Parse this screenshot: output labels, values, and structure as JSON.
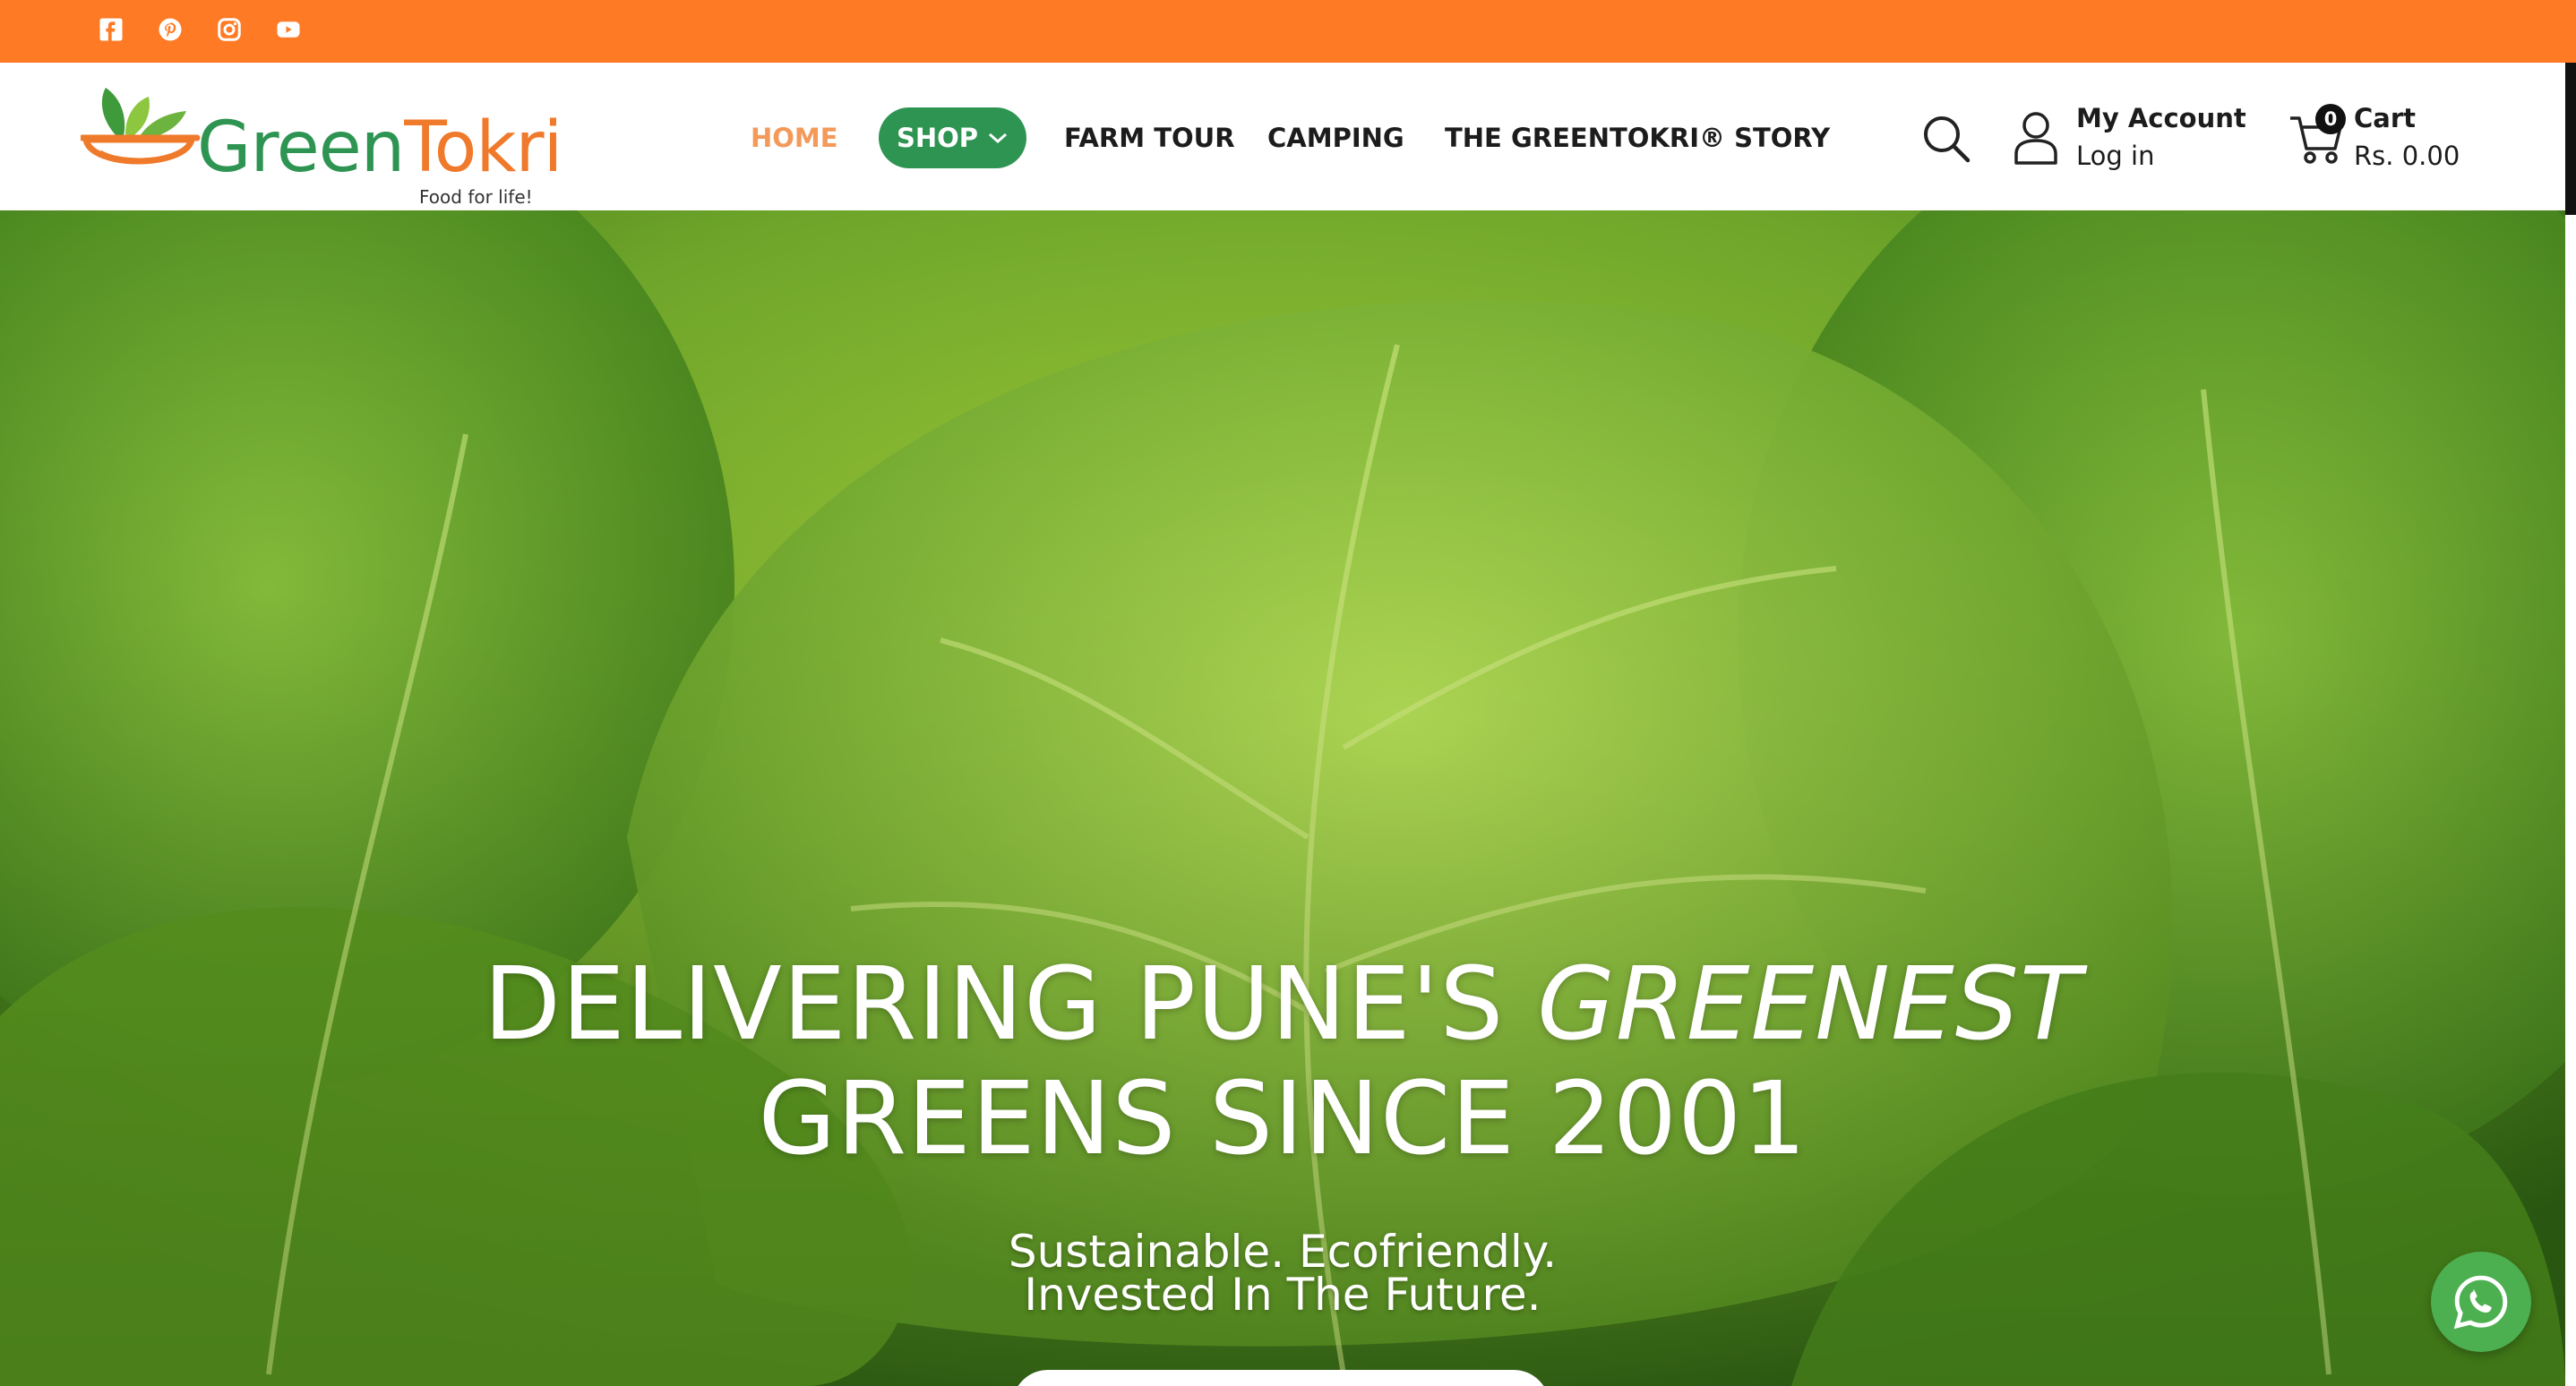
{
  "topbar": {
    "color": "#FF7A25",
    "social": [
      "facebook-icon",
      "pinterest-icon",
      "instagram-icon",
      "youtube-icon"
    ]
  },
  "brand": {
    "name_green": "Green",
    "name_orange": "Tokri",
    "tagline": "Food for life!",
    "green": "#2E9452",
    "orange": "#F07A2B"
  },
  "nav": {
    "home": "HOME",
    "shop": "SHOP",
    "farm_tour": "FARM TOUR",
    "camping": "CAMPING",
    "story": "THE GREENTOKRI® STORY"
  },
  "account": {
    "title": "My Account",
    "login": "Log in"
  },
  "cart": {
    "count": "0",
    "title": "Cart",
    "total": "Rs. 0.00"
  },
  "hero": {
    "line1_start": "DELIVERING PUNE'S ",
    "line1_emph": "GREENEST",
    "line2": "GREENS SINCE 2001",
    "sub1": "Sustainable. Ecofriendly.",
    "sub2": "Invested In The Future."
  },
  "whatsapp": {
    "icon": "whatsapp-icon",
    "color": "#4CAF50"
  }
}
